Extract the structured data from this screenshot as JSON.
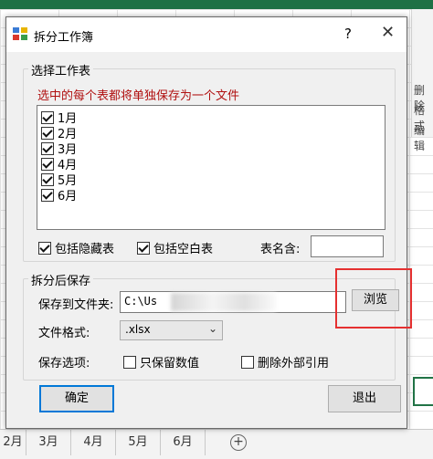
{
  "background": {
    "ribbon_labels": [
      "删除",
      "格式",
      "编辑"
    ],
    "sheet_tabs": [
      "2月",
      "3月",
      "4月",
      "5月",
      "6月"
    ],
    "add_sheet": "+"
  },
  "dialog": {
    "title": "拆分工作簿",
    "help": "?",
    "close": "✕",
    "select_group": {
      "legend": "选择工作表",
      "hint": "选中的每个表都将单独保存为一个文件",
      "sheets": [
        {
          "label": "1月",
          "checked": true
        },
        {
          "label": "2月",
          "checked": true
        },
        {
          "label": "3月",
          "checked": true
        },
        {
          "label": "4月",
          "checked": true
        },
        {
          "label": "5月",
          "checked": true
        },
        {
          "label": "6月",
          "checked": true
        }
      ],
      "include_hidden_label": "包括隐藏表",
      "include_blank_label": "包括空白表",
      "table_name_label": "表名含:",
      "table_name_value": ""
    },
    "save_group": {
      "legend": "拆分后保存",
      "save_to_label": "保存到文件夹:",
      "save_to_value": "C:\\Us",
      "browse_label": "浏览",
      "format_label": "文件格式:",
      "format_value": ".xlsx",
      "options_label": "保存选项:",
      "keep_values_label": "只保留数值",
      "remove_links_label": "删除外部引用"
    },
    "ok_label": "确定",
    "exit_label": "退出"
  },
  "colors": {
    "accent": "#0078d7",
    "hint": "#b01010",
    "highlight": "#e53030",
    "excel_green": "#1e7145"
  }
}
